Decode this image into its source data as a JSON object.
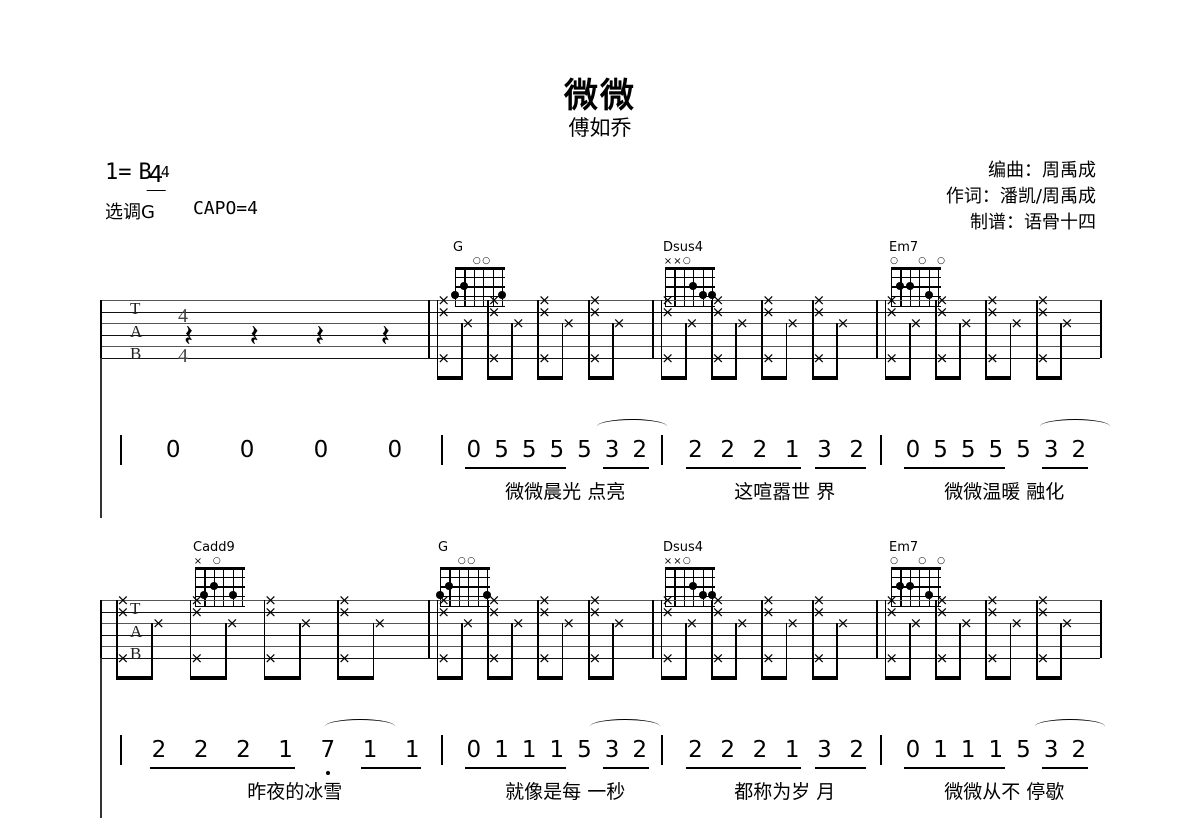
{
  "header": {
    "title": "微微",
    "artist": "傅如乔",
    "key_prefix": "1=",
    "key": "B",
    "time_num": "4",
    "time_den": "4",
    "played_key": "选调G",
    "capo": "CAPO=4",
    "credits": [
      "编曲：周禹成",
      "作词：潘凯/周禹成",
      "制谱：语骨十四"
    ]
  },
  "tab": {
    "clef": [
      "T",
      "A",
      "B"
    ],
    "time_top": "4",
    "time_bottom": "4"
  },
  "chords": [
    {
      "name": "G",
      "marks": "..oo..",
      "frets": "320003"
    },
    {
      "name": "Dsus4",
      "marks": "xxo...",
      "frets": "xx0233"
    },
    {
      "name": "Em7",
      "marks": "o..o.o",
      "frets": "022030"
    },
    {
      "name": "Cadd9",
      "marks": "x.o...",
      "frets": "x32030"
    }
  ],
  "systems": [
    {
      "chord_labels": [
        "G",
        "Dsus4",
        "Em7"
      ],
      "measures": [
        {
          "type": "rest",
          "rests": 4
        },
        {
          "type": "strum"
        },
        {
          "type": "strum"
        },
        {
          "type": "strum"
        }
      ],
      "jianpu": [
        {
          "notes": [
            "0",
            "0",
            "0",
            "0"
          ],
          "lyric": ""
        },
        {
          "notes": [
            "0",
            "5",
            "5",
            "5",
            "5",
            "3",
            "2"
          ],
          "lyric": "微微晨光  点亮"
        },
        {
          "notes": [
            "2",
            "2",
            "2",
            "1",
            "3",
            "2"
          ],
          "lyric": "这喧嚣世   界"
        },
        {
          "notes": [
            "0",
            "5",
            "5",
            "5",
            "5",
            "3",
            "2"
          ],
          "lyric": "微微温暖  融化"
        }
      ]
    },
    {
      "chord_labels": [
        "Cadd9",
        "G",
        "Dsus4",
        "Em7"
      ],
      "measures": [
        {
          "type": "strum"
        },
        {
          "type": "strum"
        },
        {
          "type": "strum"
        },
        {
          "type": "strum"
        }
      ],
      "jianpu": [
        {
          "notes": [
            "2",
            "2",
            "2",
            "1",
            "7",
            "1",
            "1"
          ],
          "lyric": "昨夜的冰雪"
        },
        {
          "notes": [
            "0",
            "1",
            "1",
            "1",
            "5",
            "3",
            "2"
          ],
          "lyric": "就像是每  一秒"
        },
        {
          "notes": [
            "2",
            "2",
            "2",
            "1",
            "3",
            "2"
          ],
          "lyric": "都称为岁   月"
        },
        {
          "notes": [
            "0",
            "1",
            "1",
            "1",
            "5",
            "3",
            "2"
          ],
          "lyric": "微微从不  停歇"
        }
      ]
    }
  ],
  "colors": {
    "ink": "#000000",
    "staff_line": "#555555",
    "paper": "#ffffff"
  }
}
